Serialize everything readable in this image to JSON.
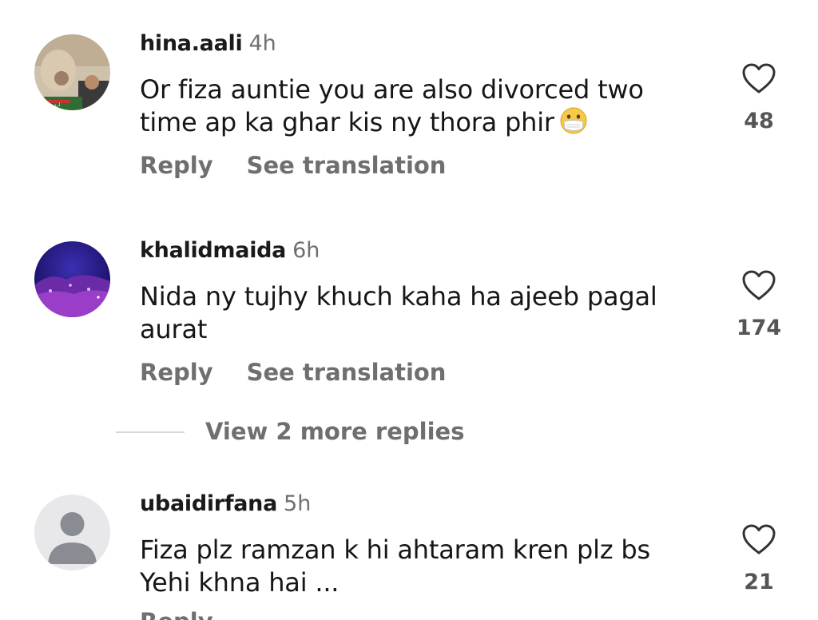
{
  "comments": [
    {
      "username": "hina.aali",
      "time": "4h",
      "text": "Or fiza auntie you are also divorced two time ap ka ghar kis ny thora phir",
      "emoji": "mask-face-emoji",
      "likes": "48",
      "reply_label": "Reply",
      "translate_label": "See translation"
    },
    {
      "username": "khalidmaida",
      "time": "6h",
      "text": "Nida ny tujhy khuch kaha ha ajeeb pagal aurat",
      "likes": "174",
      "reply_label": "Reply",
      "translate_label": "See translation"
    },
    {
      "username": "ubaidirfana",
      "time": "5h",
      "text": "Fiza plz ramzan k hi ahtaram kren plz bs Yehi khna hai ...",
      "likes": "21",
      "reply_label": "Reply"
    }
  ],
  "view_more_replies": "View 2 more replies",
  "colors": {
    "secondary_text": "#6f6f6f",
    "divider": "#d6d6d6",
    "default_avatar_bg": "#e8e8ea",
    "default_avatar_fg": "#8a8c93"
  }
}
